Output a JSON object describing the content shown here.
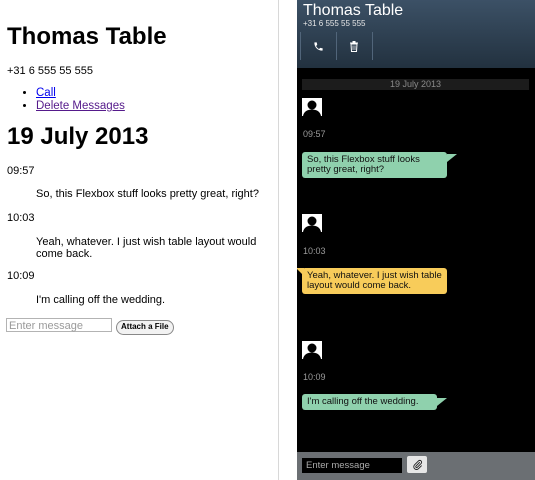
{
  "contact": {
    "name": "Thomas Table",
    "phone": "+31 6 555 55 555"
  },
  "actions": {
    "call": "Call",
    "delete": "Delete Messages"
  },
  "conversation": {
    "date": "19 July 2013",
    "messages": [
      {
        "time": "09:57",
        "text": "So, this Flexbox stuff looks pretty great, right?"
      },
      {
        "time": "10:03",
        "text": "Yeah, whatever. I just wish table layout would come back."
      },
      {
        "time": "10:09",
        "text": "I'm calling off the wedding."
      }
    ]
  },
  "composer": {
    "placeholder": "Enter message",
    "attach_label": "Attach a File"
  },
  "icons": {
    "call": "phone-icon",
    "delete": "trash-icon",
    "attach": "paperclip-icon",
    "avatar": "avatar-icon"
  },
  "colors": {
    "header": "#2f4254",
    "bubble_green": "#8fd1ad",
    "bubble_yellow": "#f8cc5a",
    "background": "#000000",
    "footer": "#6b6f73"
  }
}
